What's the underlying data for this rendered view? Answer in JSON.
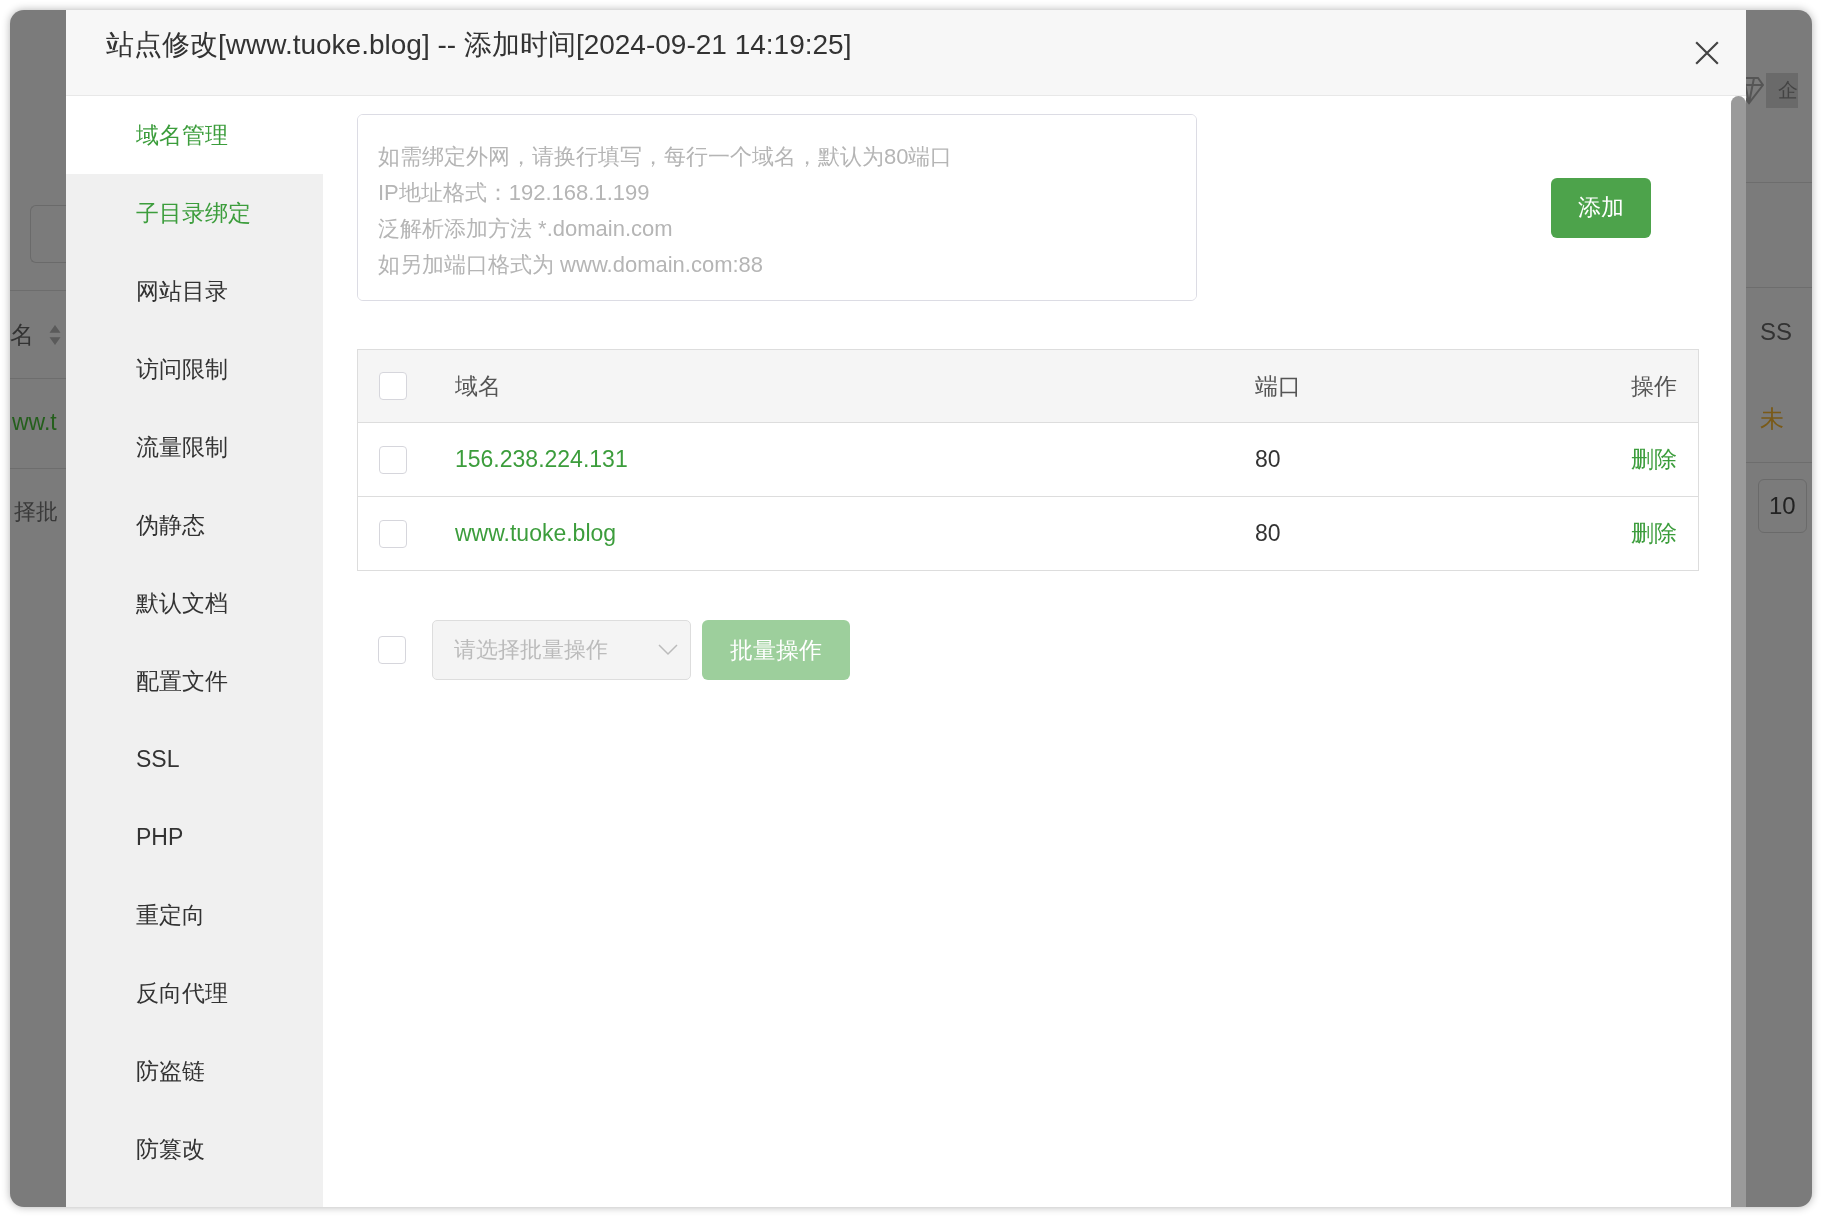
{
  "window": {
    "title": "站点修改[www.tuoke.blog] -- 添加时间[2024-09-21 14:19:25]"
  },
  "background_page": {
    "left": [
      {
        "kind": "toolbar"
      },
      {
        "kind": "sort-header",
        "text": "名"
      },
      {
        "kind": "link",
        "text": "ww.t"
      },
      {
        "kind": "field",
        "text": "择批"
      }
    ],
    "right": [
      {
        "kind": "badge",
        "text": "企"
      },
      {
        "kind": "blank"
      },
      {
        "kind": "header",
        "text": "SS"
      },
      {
        "kind": "status",
        "text": "未"
      },
      {
        "kind": "field",
        "text": "10"
      }
    ]
  },
  "sidebar": {
    "items": [
      {
        "label": "域名管理",
        "selected": true,
        "emphasized": true
      },
      {
        "label": "子目录绑定",
        "selected": false,
        "emphasized": true
      },
      {
        "label": "网站目录",
        "selected": false,
        "emphasized": false
      },
      {
        "label": "访问限制",
        "selected": false,
        "emphasized": false
      },
      {
        "label": "流量限制",
        "selected": false,
        "emphasized": false
      },
      {
        "label": "伪静态",
        "selected": false,
        "emphasized": false
      },
      {
        "label": "默认文档",
        "selected": false,
        "emphasized": false
      },
      {
        "label": "配置文件",
        "selected": false,
        "emphasized": false
      },
      {
        "label": "SSL",
        "selected": false,
        "emphasized": false
      },
      {
        "label": "PHP",
        "selected": false,
        "emphasized": false
      },
      {
        "label": "重定向",
        "selected": false,
        "emphasized": false
      },
      {
        "label": "反向代理",
        "selected": false,
        "emphasized": false
      },
      {
        "label": "防盗链",
        "selected": false,
        "emphasized": false
      },
      {
        "label": "防篡改",
        "selected": false,
        "emphasized": false
      }
    ]
  },
  "domain_field": {
    "placeholder": "如需绑定外网，请换行填写，每行一个域名，默认为80端口\nIP地址格式：192.168.1.199\n泛解析添加方法 *.domain.com\n如另加端口格式为 www.domain.com:88"
  },
  "add_button": "添加",
  "table": {
    "header_checked": false,
    "columns": [
      "域名",
      "端口",
      "操作"
    ],
    "rows": [
      {
        "checked": false,
        "domain": "156.238.224.131",
        "port": "80",
        "action": "删除"
      },
      {
        "checked": false,
        "domain": "www.tuoke.blog",
        "port": "80",
        "action": "删除"
      }
    ]
  },
  "batch": {
    "checked": false,
    "select_placeholder": "请选择批量操作",
    "button": "批量操作",
    "disabled": true
  }
}
